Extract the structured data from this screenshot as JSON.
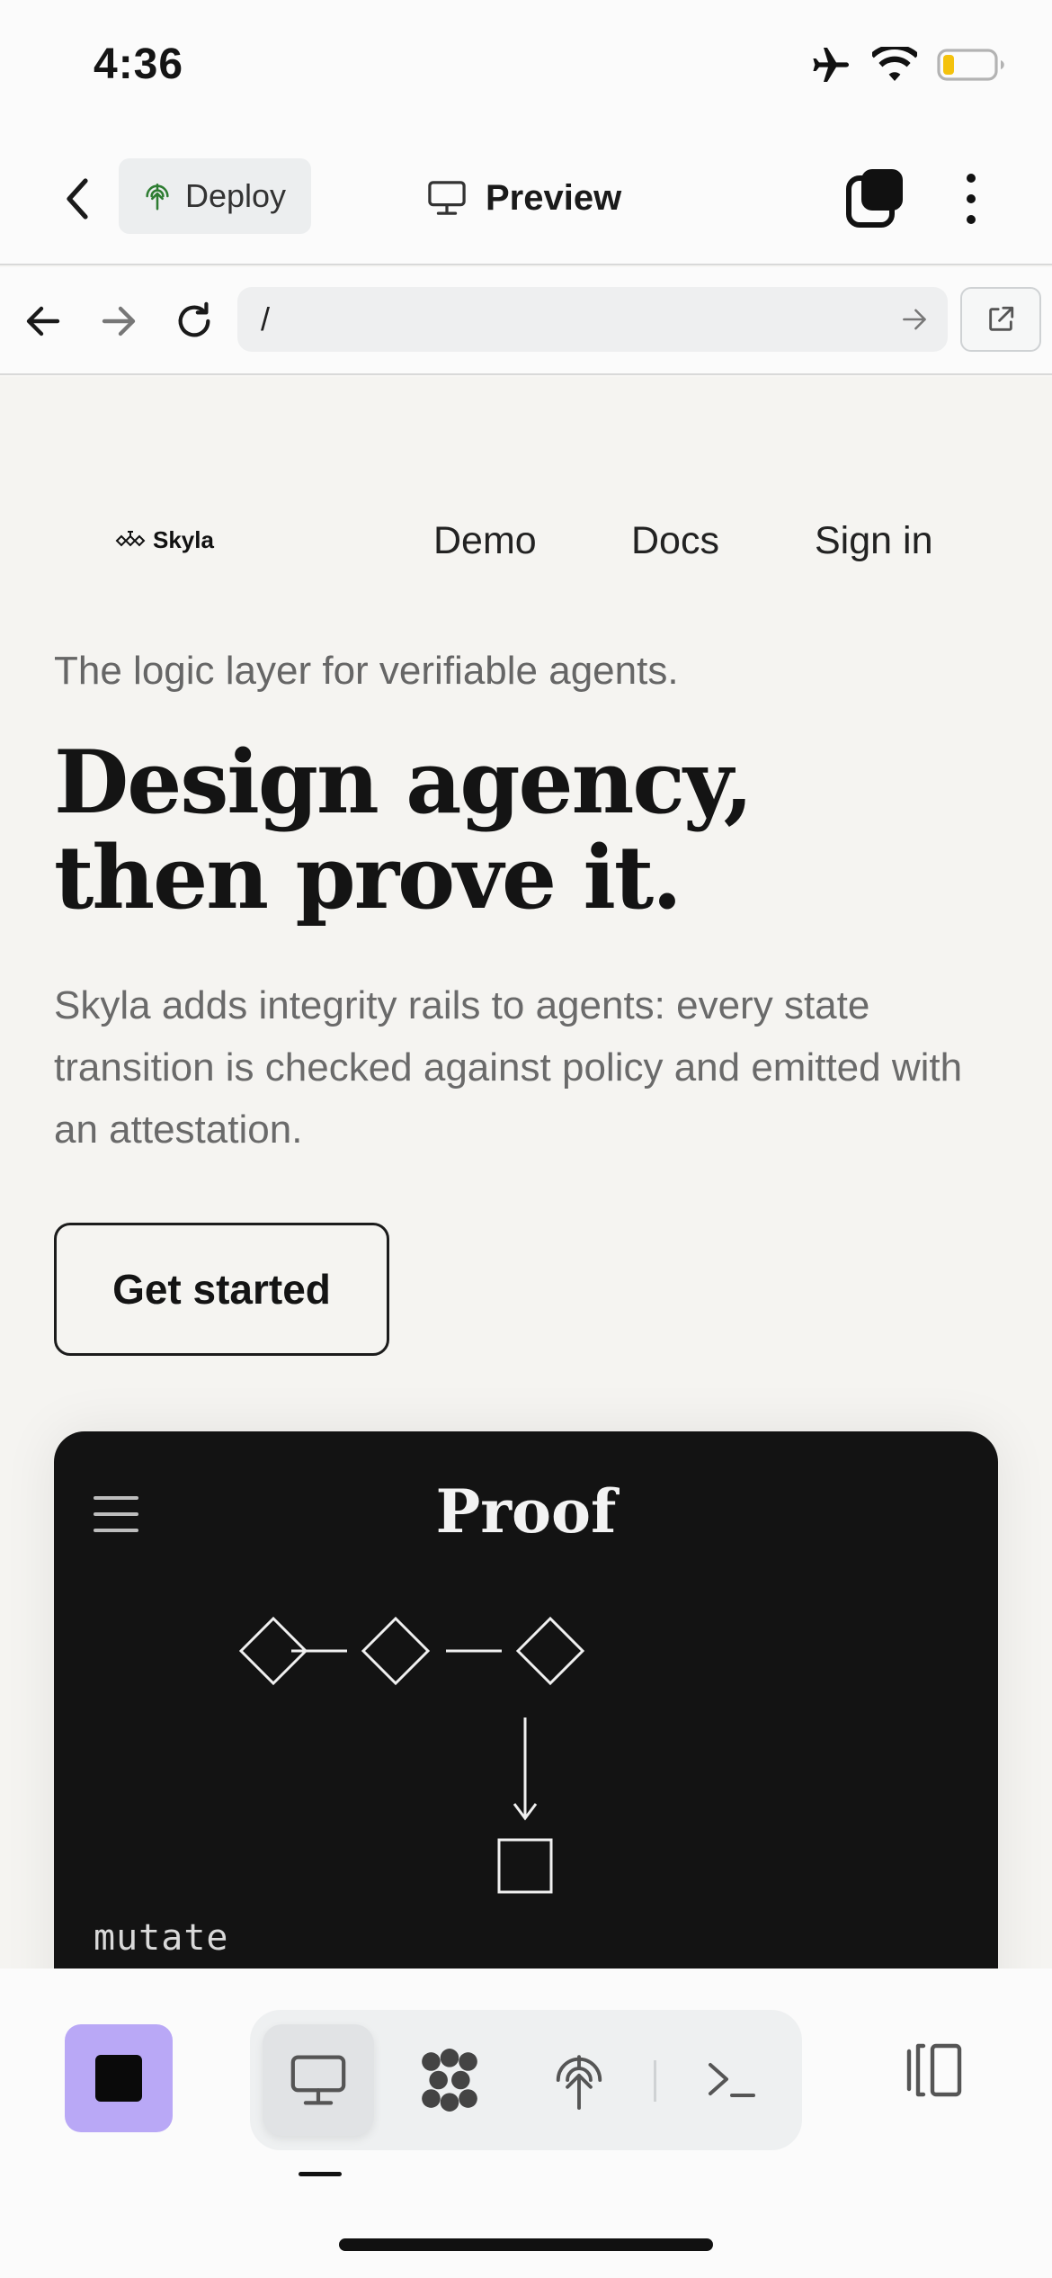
{
  "status_bar": {
    "time": "4:36"
  },
  "header": {
    "deploy_label": "Deploy",
    "preview_label": "Preview"
  },
  "browser": {
    "url_value": "/"
  },
  "site": {
    "logo_text": "Skyla",
    "nav": [
      "Demo",
      "Docs",
      "Sign in"
    ],
    "tagline": "The logic layer for verifiable agents.",
    "headline_line1": "Design agency,",
    "headline_line2": "then prove it.",
    "description": "Skyla adds integrity rails to agents: every state transition is checked against policy and emitted with an attestation.",
    "cta_label": "Get started",
    "proof_card": {
      "title": "Proof",
      "code_label": "mutate"
    }
  },
  "toolbar": {
    "modes": [
      {
        "name": "preview",
        "icon": "monitor-icon",
        "active": true
      },
      {
        "name": "graph",
        "icon": "nodes-icon",
        "active": false
      },
      {
        "name": "deploy",
        "icon": "deploy-tree-icon",
        "active": false
      },
      {
        "name": "terminal",
        "icon": "terminal-icon",
        "active": false
      }
    ]
  },
  "colors": {
    "accent_stop": "#b9a8f6",
    "deploy_icon_green": "#2e7d32",
    "battery_low": "#f4c20d",
    "card_bg": "#131313",
    "page_bg": "#f5f4f1"
  }
}
